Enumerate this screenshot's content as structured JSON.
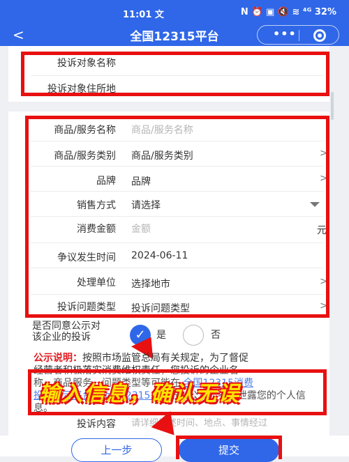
{
  "status_bar": {
    "time": "11:01",
    "time_suffix": "文",
    "indicators": "N ⏰ ▣ 🔇 ≋ ⁴ᴳ 32%"
  },
  "nav": {
    "back_glyph": "<",
    "title": "全国12315平台",
    "more_glyph": "•••"
  },
  "object_section": {
    "name_label": "投诉对象名称",
    "address_label": "投诉对象住所地"
  },
  "form": {
    "product_name": {
      "label": "商品/服务名称",
      "placeholder": "商品/服务名称"
    },
    "product_type": {
      "label": "商品/服务类别",
      "value": "商品/服务类别"
    },
    "brand": {
      "label": "品牌",
      "value": "品牌"
    },
    "sale_method": {
      "label": "销售方式",
      "value": "请选择"
    },
    "amount": {
      "label": "消费金额",
      "placeholder": "金额",
      "unit": "元"
    },
    "dispute_time": {
      "label": "争议发生时间",
      "value": "2024-06-11"
    },
    "handler": {
      "label": "处理单位",
      "value": "选择地市"
    },
    "issue_type": {
      "label": "投诉问题类型",
      "value": "投诉问题类型"
    }
  },
  "publicity": {
    "label_line1": "是否同意公示对",
    "label_line2": "该企业的投诉",
    "yes": "是",
    "no": "否",
    "yes_selected": true
  },
  "notice": {
    "heading": "公示说明：",
    "line1": "按照市场监管总局有关规定，为了督促",
    "line2": "经营者积极落实消费维权责任，您投诉的企业名",
    "line3_pre": "称、商品服务、问题类型等可能在",
    "link1": "全国12315消费",
    "line4_link": "投诉公示平台(tsgs.12315.cn)",
    "line4_post": "予以公示，不会泄露您的个人信息。"
  },
  "banner": {
    "text": "输入信息，确认无误"
  },
  "content": {
    "label": "投诉内容",
    "placeholder": "请详细描述时间、地点、事情经过"
  },
  "buttons": {
    "prev": "上一步",
    "submit": "提交"
  }
}
